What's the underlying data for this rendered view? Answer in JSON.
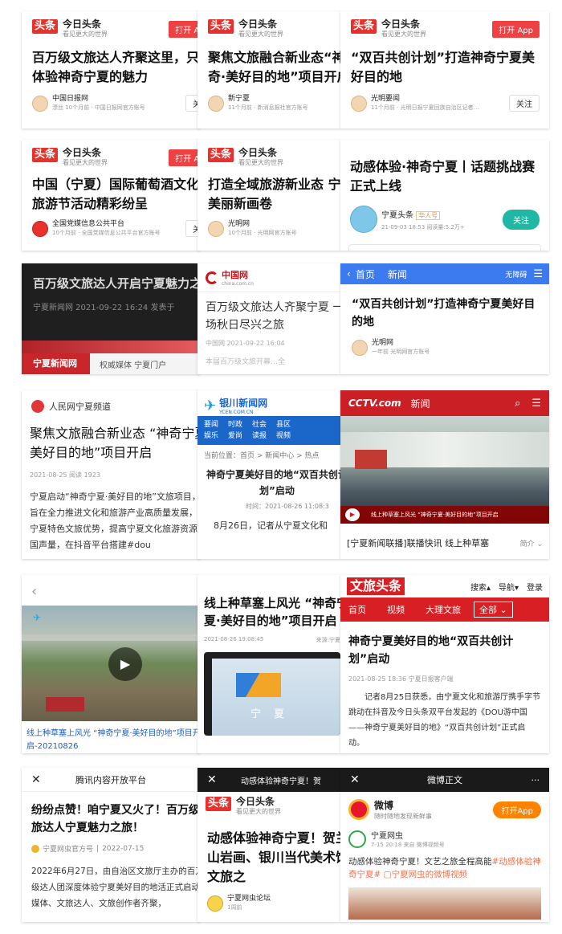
{
  "colors": {
    "toutiao_red": "#e8312c",
    "cctv_red": "#c91f25",
    "ycen_blue": "#1b67c9",
    "wenlv_red": "#d71f24",
    "teal": "#1fb8a5"
  },
  "r1": {
    "c1": {
      "logo": "头条",
      "brand": "今日头条",
      "slogan": "看见更大的世界",
      "open": "打开 App",
      "title": "百万级文旅达人齐聚这里，只为体验神奇宁夏的魅力",
      "source": "中国日报网",
      "meta": "漂丝 10个月前 · 中国日报网官方账号",
      "follow": "关注"
    },
    "c2": {
      "logo": "头条",
      "brand": "今日头条",
      "slogan": "看见更大的世界",
      "title": "聚焦文旅融合新业态“神奇·美好目的地”项目开启",
      "source": "新宁夏",
      "meta": "11个月前 · 新消息报社官方账号"
    },
    "c3": {
      "logo": "头条",
      "brand": "今日头条",
      "slogan": "看见更大的世界",
      "open": "打开 App",
      "title": "“双百共创计划”打造神奇宁夏美好目的地",
      "source": "光明要闻",
      "meta": "11个月前 · 光明日报宁夏回族自治区记者…",
      "follow": "关注"
    }
  },
  "r2": {
    "c1": {
      "logo": "头条",
      "brand": "今日头条",
      "slogan": "看见更大的世界",
      "open": "打开 App",
      "title": "中国（宁夏）国际葡萄酒文化旅游节活动精彩纷呈",
      "source": "全国党媒信息公共平台",
      "meta": "10个月前 · 全国党媒信息公共平台官方账号",
      "follow": "关注"
    },
    "c2": {
      "logo": "头条",
      "brand": "今日头条",
      "slogan": "看见更大的世界",
      "title": "打造全域旅游新业态 宁夏美丽新画卷",
      "source": "光明网",
      "meta": "10个月前 · 光明网官方账号"
    },
    "c3": {
      "title": "动感体验·神奇宁夏丨话题挑战赛正式上线",
      "source": "宁夏头条",
      "tag": "华人号",
      "meta": "21-09-03 18:53   阅读量:5.2万+",
      "follow": "关注"
    }
  },
  "r3": {
    "c1": {
      "title": "百万级文旅达人开启宁夏魅力之旅",
      "meta": "宁夏新闻网  2021-09-22 16:24  发表于",
      "banner": "宁夏新闻网",
      "slogan": "权威媒体  宁夏门户"
    },
    "c2": {
      "logo": "中国网",
      "domain": "china.com.cn",
      "title": "百万级文旅达人齐聚宁夏 一场秋日尽兴之旅",
      "meta": "中国网 2021-09-22 16:04",
      "snippet": "本届百万级文旅开幕…全"
    },
    "c3": {
      "back": "首页",
      "section": "新闻",
      "access": "无障碍",
      "title": "“双百共创计划”打造神奇宁夏美好目的地",
      "source": "光明网",
      "meta": "一年前   光明网官方账号"
    }
  },
  "r4": {
    "c1": {
      "site": "人民网宁夏频道",
      "title": "聚焦文旅融合新业态 “神奇宁夏·美好目的地”项目开启",
      "meta": "2021-08-25  阅读 1923",
      "body": "宁夏启动“神奇宁夏·美好目的地”文旅项目，项目旨在全力推进文化和旅游产业高质量发展，深挖宁夏特色文旅优势，提高宁夏文化旅游资源的全国声量，在抖音平台搭建#dou"
    },
    "c2": {
      "logo": "银川新闻网",
      "domain": "YCEN.COM.CN",
      "nav1": [
        "要闻",
        "时政",
        "社会",
        "县区"
      ],
      "nav2": [
        "娱乐",
        "爱尚",
        "读报",
        "视频"
      ],
      "crumb": "当前位置：首页 > 新闻中心 > 热点",
      "title": "神奇宁夏美好目的地“双百共创计划”启动",
      "time": "时间：2021-08-26 11:08:3",
      "body": "8月26日，记者从宁夏文化和"
    },
    "c3": {
      "logo": "CCTV.com",
      "section": "新闻",
      "video_caption": "线上种草塞上风光 “神奇宁夏·美好目的地”项目开启",
      "title": "[宁夏新闻联播]联播快讯 线上种草塞",
      "more": "简介"
    }
  },
  "r5": {
    "c1": {
      "caption": "线上种草塞上风光 “神奇宁夏·美好目的地”项目开启-20210826"
    },
    "c2": {
      "title": "线上种草塞上风光 “神奇宁夏·美好目的地”项目开启",
      "date": "2021-08-26 19:08:45",
      "src": "来源:宁夏",
      "video_text": "宁 夏"
    },
    "c3": {
      "logo": "文旅头条",
      "search": "搜索",
      "nav": "导航",
      "login": "登录",
      "tabs": [
        "首页",
        "视频",
        "大理文旅",
        "全部"
      ],
      "title": "神奇宁夏美好目的地“双百共创计划”启动",
      "meta": "2021-08-25 18:36  宁夏日报客户端",
      "body": "记者8月25日获悉，由宁夏文化和旅游厅携手字节跳动在抖音及今日头条双平台发起的《DOU游中国——神奇宁夏美好目的地》“双百共创计划”正式启动。"
    }
  },
  "r6": {
    "c1": {
      "bar": "腾讯内容开放平台",
      "title": "纷纷点赞！咱宁夏又火了！百万级文旅达人宁夏魅力之旅！",
      "source": "宁夏网虫官方号",
      "date": "2022-07-15",
      "body": "2022年6月27日，由自治区文旅厅主办的百万级达人团深度体验宁夏美好目的地活正式启动。媒体、文旅达人、文旅创作者齐聚，"
    },
    "c2": {
      "bar": "动感体验神奇宁夏！贺",
      "logo": "头条",
      "brand": "今日头条",
      "slogan": "看见更大的世界",
      "title": "动感体验神奇宁夏！贺兰山岩画、银川当代美术馆文旅之",
      "source": "宁夏网虫论坛",
      "meta": "1周前"
    },
    "c3": {
      "bar": "微博正文",
      "brand": "微博",
      "slogan": "随时随地发现新鲜事",
      "open": "打开App",
      "user": "宁夏网虫",
      "meta": "7-15 20:18  来自 微博视频号",
      "text": "动感体验神奇宁夏！文艺之旅全程高能",
      "hashtag": "#动感体验神奇宁夏#",
      "link": "宁夏网虫的微博视频"
    }
  }
}
